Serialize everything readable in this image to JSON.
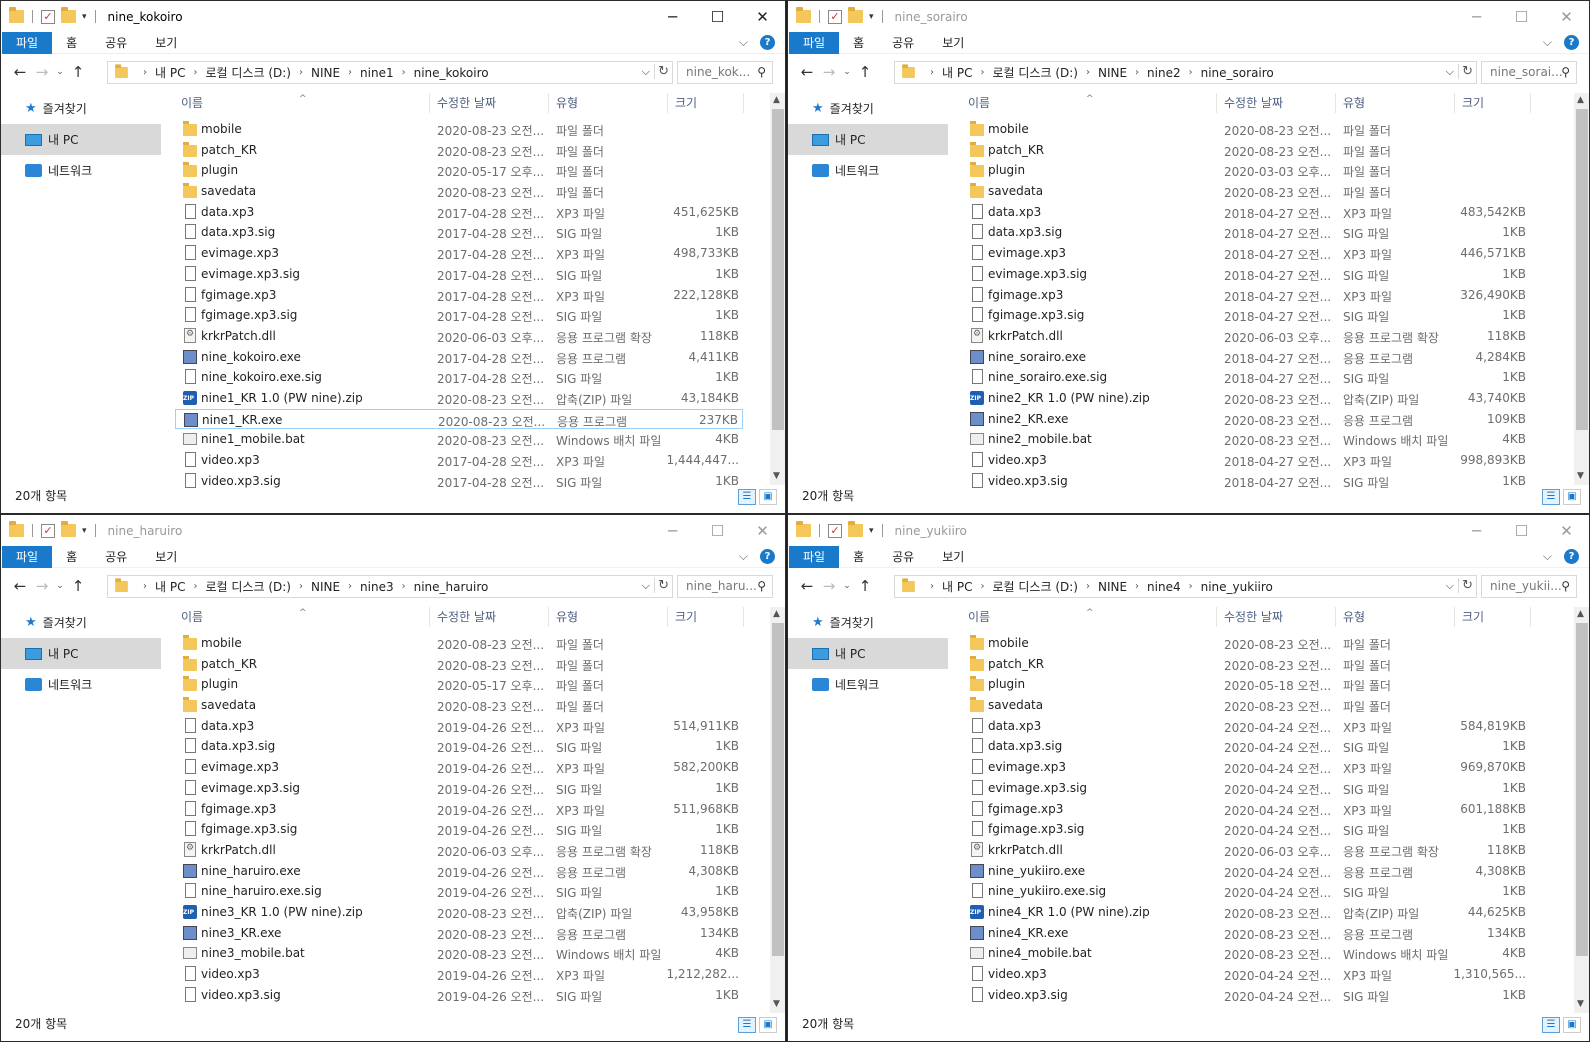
{
  "ribbon_tabs": {
    "file": "파일",
    "home": "홈",
    "share": "공유",
    "view": "보기"
  },
  "columns": {
    "name": "이름",
    "date": "수정한 날짜",
    "type": "유형",
    "size": "크기"
  },
  "nav": {
    "favorites": "즐겨찾기",
    "this_pc": "내 PC",
    "network": "네트워크"
  },
  "common_crumbs": [
    "내 PC",
    "로컬 디스크 (D:)",
    "NINE"
  ],
  "windows": [
    {
      "title": "nine_kokoiro",
      "folder": "nine1",
      "search_placeholder": "nine_kok...",
      "status": "20개 항목",
      "files": [
        {
          "name": "mobile",
          "date": "2020-08-23 오전...",
          "type": "파일 폴더",
          "size": "",
          "icon": "folder"
        },
        {
          "name": "patch_KR",
          "date": "2020-08-23 오전...",
          "type": "파일 폴더",
          "size": "",
          "icon": "folder"
        },
        {
          "name": "plugin",
          "date": "2020-05-17 오후...",
          "type": "파일 폴더",
          "size": "",
          "icon": "folder"
        },
        {
          "name": "savedata",
          "date": "2020-08-23 오전...",
          "type": "파일 폴더",
          "size": "",
          "icon": "folder"
        },
        {
          "name": "data.xp3",
          "date": "2017-04-28 오전...",
          "type": "XP3 파일",
          "size": "451,625KB",
          "icon": "file"
        },
        {
          "name": "data.xp3.sig",
          "date": "2017-04-28 오전...",
          "type": "SIG 파일",
          "size": "1KB",
          "icon": "file"
        },
        {
          "name": "evimage.xp3",
          "date": "2017-04-28 오전...",
          "type": "XP3 파일",
          "size": "498,733KB",
          "icon": "file"
        },
        {
          "name": "evimage.xp3.sig",
          "date": "2017-04-28 오전...",
          "type": "SIG 파일",
          "size": "1KB",
          "icon": "file"
        },
        {
          "name": "fgimage.xp3",
          "date": "2017-04-28 오전...",
          "type": "XP3 파일",
          "size": "222,128KB",
          "icon": "file"
        },
        {
          "name": "fgimage.xp3.sig",
          "date": "2017-04-28 오전...",
          "type": "SIG 파일",
          "size": "1KB",
          "icon": "file"
        },
        {
          "name": "krkrPatch.dll",
          "date": "2020-06-03 오후...",
          "type": "응용 프로그램 확장",
          "size": "118KB",
          "icon": "dll"
        },
        {
          "name": "nine_kokoiro.exe",
          "date": "2017-04-28 오전...",
          "type": "응용 프로그램",
          "size": "4,411KB",
          "icon": "exe"
        },
        {
          "name": "nine_kokoiro.exe.sig",
          "date": "2017-04-28 오전...",
          "type": "SIG 파일",
          "size": "1KB",
          "icon": "file"
        },
        {
          "name": "nine1_KR 1.0 (PW nine).zip",
          "date": "2020-08-23 오전...",
          "type": "압축(ZIP) 파일",
          "size": "43,184KB",
          "icon": "zip"
        },
        {
          "name": "nine1_KR.exe",
          "date": "2020-08-23 오전...",
          "type": "응용 프로그램",
          "size": "237KB",
          "icon": "exe",
          "selected": true
        },
        {
          "name": "nine1_mobile.bat",
          "date": "2020-08-23 오전...",
          "type": "Windows 배치 파일",
          "size": "4KB",
          "icon": "bat"
        },
        {
          "name": "video.xp3",
          "date": "2017-04-28 오전...",
          "type": "XP3 파일",
          "size": "1,444,447...",
          "icon": "file"
        },
        {
          "name": "video.xp3.sig",
          "date": "2017-04-28 오전...",
          "type": "SIG 파일",
          "size": "1KB",
          "icon": "file"
        }
      ]
    },
    {
      "title": "nine_sorairo",
      "folder": "nine2",
      "search_placeholder": "nine_sorai...",
      "status": "20개 항목",
      "files": [
        {
          "name": "mobile",
          "date": "2020-08-23 오전...",
          "type": "파일 폴더",
          "size": "",
          "icon": "folder"
        },
        {
          "name": "patch_KR",
          "date": "2020-08-23 오전...",
          "type": "파일 폴더",
          "size": "",
          "icon": "folder"
        },
        {
          "name": "plugin",
          "date": "2020-03-03 오후...",
          "type": "파일 폴더",
          "size": "",
          "icon": "folder"
        },
        {
          "name": "savedata",
          "date": "2020-08-23 오전...",
          "type": "파일 폴더",
          "size": "",
          "icon": "folder"
        },
        {
          "name": "data.xp3",
          "date": "2018-04-27 오전...",
          "type": "XP3 파일",
          "size": "483,542KB",
          "icon": "file"
        },
        {
          "name": "data.xp3.sig",
          "date": "2018-04-27 오전...",
          "type": "SIG 파일",
          "size": "1KB",
          "icon": "file"
        },
        {
          "name": "evimage.xp3",
          "date": "2018-04-27 오전...",
          "type": "XP3 파일",
          "size": "446,571KB",
          "icon": "file"
        },
        {
          "name": "evimage.xp3.sig",
          "date": "2018-04-27 오전...",
          "type": "SIG 파일",
          "size": "1KB",
          "icon": "file"
        },
        {
          "name": "fgimage.xp3",
          "date": "2018-04-27 오전...",
          "type": "XP3 파일",
          "size": "326,490KB",
          "icon": "file"
        },
        {
          "name": "fgimage.xp3.sig",
          "date": "2018-04-27 오전...",
          "type": "SIG 파일",
          "size": "1KB",
          "icon": "file"
        },
        {
          "name": "krkrPatch.dll",
          "date": "2020-06-03 오후...",
          "type": "응용 프로그램 확장",
          "size": "118KB",
          "icon": "dll"
        },
        {
          "name": "nine_sorairo.exe",
          "date": "2018-04-27 오전...",
          "type": "응용 프로그램",
          "size": "4,284KB",
          "icon": "exe"
        },
        {
          "name": "nine_sorairo.exe.sig",
          "date": "2018-04-27 오전...",
          "type": "SIG 파일",
          "size": "1KB",
          "icon": "file"
        },
        {
          "name": "nine2_KR 1.0 (PW nine).zip",
          "date": "2020-08-23 오전...",
          "type": "압축(ZIP) 파일",
          "size": "43,740KB",
          "icon": "zip"
        },
        {
          "name": "nine2_KR.exe",
          "date": "2020-08-23 오전...",
          "type": "응용 프로그램",
          "size": "109KB",
          "icon": "exe"
        },
        {
          "name": "nine2_mobile.bat",
          "date": "2020-08-23 오전...",
          "type": "Windows 배치 파일",
          "size": "4KB",
          "icon": "bat"
        },
        {
          "name": "video.xp3",
          "date": "2018-04-27 오전...",
          "type": "XP3 파일",
          "size": "998,893KB",
          "icon": "file"
        },
        {
          "name": "video.xp3.sig",
          "date": "2018-04-27 오전...",
          "type": "SIG 파일",
          "size": "1KB",
          "icon": "file"
        }
      ]
    },
    {
      "title": "nine_haruiro",
      "folder": "nine3",
      "search_placeholder": "nine_haru...",
      "status": "20개 항목",
      "files": [
        {
          "name": "mobile",
          "date": "2020-08-23 오전...",
          "type": "파일 폴더",
          "size": "",
          "icon": "folder"
        },
        {
          "name": "patch_KR",
          "date": "2020-08-23 오전...",
          "type": "파일 폴더",
          "size": "",
          "icon": "folder"
        },
        {
          "name": "plugin",
          "date": "2020-05-17 오후...",
          "type": "파일 폴더",
          "size": "",
          "icon": "folder"
        },
        {
          "name": "savedata",
          "date": "2020-08-23 오전...",
          "type": "파일 폴더",
          "size": "",
          "icon": "folder"
        },
        {
          "name": "data.xp3",
          "date": "2019-04-26 오전...",
          "type": "XP3 파일",
          "size": "514,911KB",
          "icon": "file"
        },
        {
          "name": "data.xp3.sig",
          "date": "2019-04-26 오전...",
          "type": "SIG 파일",
          "size": "1KB",
          "icon": "file"
        },
        {
          "name": "evimage.xp3",
          "date": "2019-04-26 오전...",
          "type": "XP3 파일",
          "size": "582,200KB",
          "icon": "file"
        },
        {
          "name": "evimage.xp3.sig",
          "date": "2019-04-26 오전...",
          "type": "SIG 파일",
          "size": "1KB",
          "icon": "file"
        },
        {
          "name": "fgimage.xp3",
          "date": "2019-04-26 오전...",
          "type": "XP3 파일",
          "size": "511,968KB",
          "icon": "file"
        },
        {
          "name": "fgimage.xp3.sig",
          "date": "2019-04-26 오전...",
          "type": "SIG 파일",
          "size": "1KB",
          "icon": "file"
        },
        {
          "name": "krkrPatch.dll",
          "date": "2020-06-03 오후...",
          "type": "응용 프로그램 확장",
          "size": "118KB",
          "icon": "dll"
        },
        {
          "name": "nine_haruiro.exe",
          "date": "2019-04-26 오전...",
          "type": "응용 프로그램",
          "size": "4,308KB",
          "icon": "exe"
        },
        {
          "name": "nine_haruiro.exe.sig",
          "date": "2019-04-26 오전...",
          "type": "SIG 파일",
          "size": "1KB",
          "icon": "file"
        },
        {
          "name": "nine3_KR 1.0 (PW nine).zip",
          "date": "2020-08-23 오전...",
          "type": "압축(ZIP) 파일",
          "size": "43,958KB",
          "icon": "zip"
        },
        {
          "name": "nine3_KR.exe",
          "date": "2020-08-23 오전...",
          "type": "응용 프로그램",
          "size": "134KB",
          "icon": "exe"
        },
        {
          "name": "nine3_mobile.bat",
          "date": "2020-08-23 오전...",
          "type": "Windows 배치 파일",
          "size": "4KB",
          "icon": "bat"
        },
        {
          "name": "video.xp3",
          "date": "2019-04-26 오전...",
          "type": "XP3 파일",
          "size": "1,212,282...",
          "icon": "file"
        },
        {
          "name": "video.xp3.sig",
          "date": "2019-04-26 오전...",
          "type": "SIG 파일",
          "size": "1KB",
          "icon": "file"
        }
      ]
    },
    {
      "title": "nine_yukiiro",
      "folder": "nine4",
      "search_placeholder": "nine_yukii...",
      "status": "20개 항목",
      "files": [
        {
          "name": "mobile",
          "date": "2020-08-23 오전...",
          "type": "파일 폴더",
          "size": "",
          "icon": "folder"
        },
        {
          "name": "patch_KR",
          "date": "2020-08-23 오전...",
          "type": "파일 폴더",
          "size": "",
          "icon": "folder"
        },
        {
          "name": "plugin",
          "date": "2020-05-18 오전...",
          "type": "파일 폴더",
          "size": "",
          "icon": "folder"
        },
        {
          "name": "savedata",
          "date": "2020-08-23 오전...",
          "type": "파일 폴더",
          "size": "",
          "icon": "folder"
        },
        {
          "name": "data.xp3",
          "date": "2020-04-24 오전...",
          "type": "XP3 파일",
          "size": "584,819KB",
          "icon": "file"
        },
        {
          "name": "data.xp3.sig",
          "date": "2020-04-24 오전...",
          "type": "SIG 파일",
          "size": "1KB",
          "icon": "file"
        },
        {
          "name": "evimage.xp3",
          "date": "2020-04-24 오전...",
          "type": "XP3 파일",
          "size": "969,870KB",
          "icon": "file"
        },
        {
          "name": "evimage.xp3.sig",
          "date": "2020-04-24 오전...",
          "type": "SIG 파일",
          "size": "1KB",
          "icon": "file"
        },
        {
          "name": "fgimage.xp3",
          "date": "2020-04-24 오전...",
          "type": "XP3 파일",
          "size": "601,188KB",
          "icon": "file"
        },
        {
          "name": "fgimage.xp3.sig",
          "date": "2020-04-24 오전...",
          "type": "SIG 파일",
          "size": "1KB",
          "icon": "file"
        },
        {
          "name": "krkrPatch.dll",
          "date": "2020-06-03 오후...",
          "type": "응용 프로그램 확장",
          "size": "118KB",
          "icon": "dll"
        },
        {
          "name": "nine_yukiiro.exe",
          "date": "2020-04-24 오전...",
          "type": "응용 프로그램",
          "size": "4,308KB",
          "icon": "exe"
        },
        {
          "name": "nine_yukiiro.exe.sig",
          "date": "2020-04-24 오전...",
          "type": "SIG 파일",
          "size": "1KB",
          "icon": "file"
        },
        {
          "name": "nine4_KR 1.0 (PW nine).zip",
          "date": "2020-08-23 오전...",
          "type": "압축(ZIP) 파일",
          "size": "44,625KB",
          "icon": "zip"
        },
        {
          "name": "nine4_KR.exe",
          "date": "2020-08-23 오전...",
          "type": "응용 프로그램",
          "size": "134KB",
          "icon": "exe"
        },
        {
          "name": "nine4_mobile.bat",
          "date": "2020-08-23 오전...",
          "type": "Windows 배치 파일",
          "size": "4KB",
          "icon": "bat"
        },
        {
          "name": "video.xp3",
          "date": "2020-04-24 오전...",
          "type": "XP3 파일",
          "size": "1,310,565...",
          "icon": "file"
        },
        {
          "name": "video.xp3.sig",
          "date": "2020-04-24 오전...",
          "type": "SIG 파일",
          "size": "1KB",
          "icon": "file"
        }
      ]
    }
  ]
}
